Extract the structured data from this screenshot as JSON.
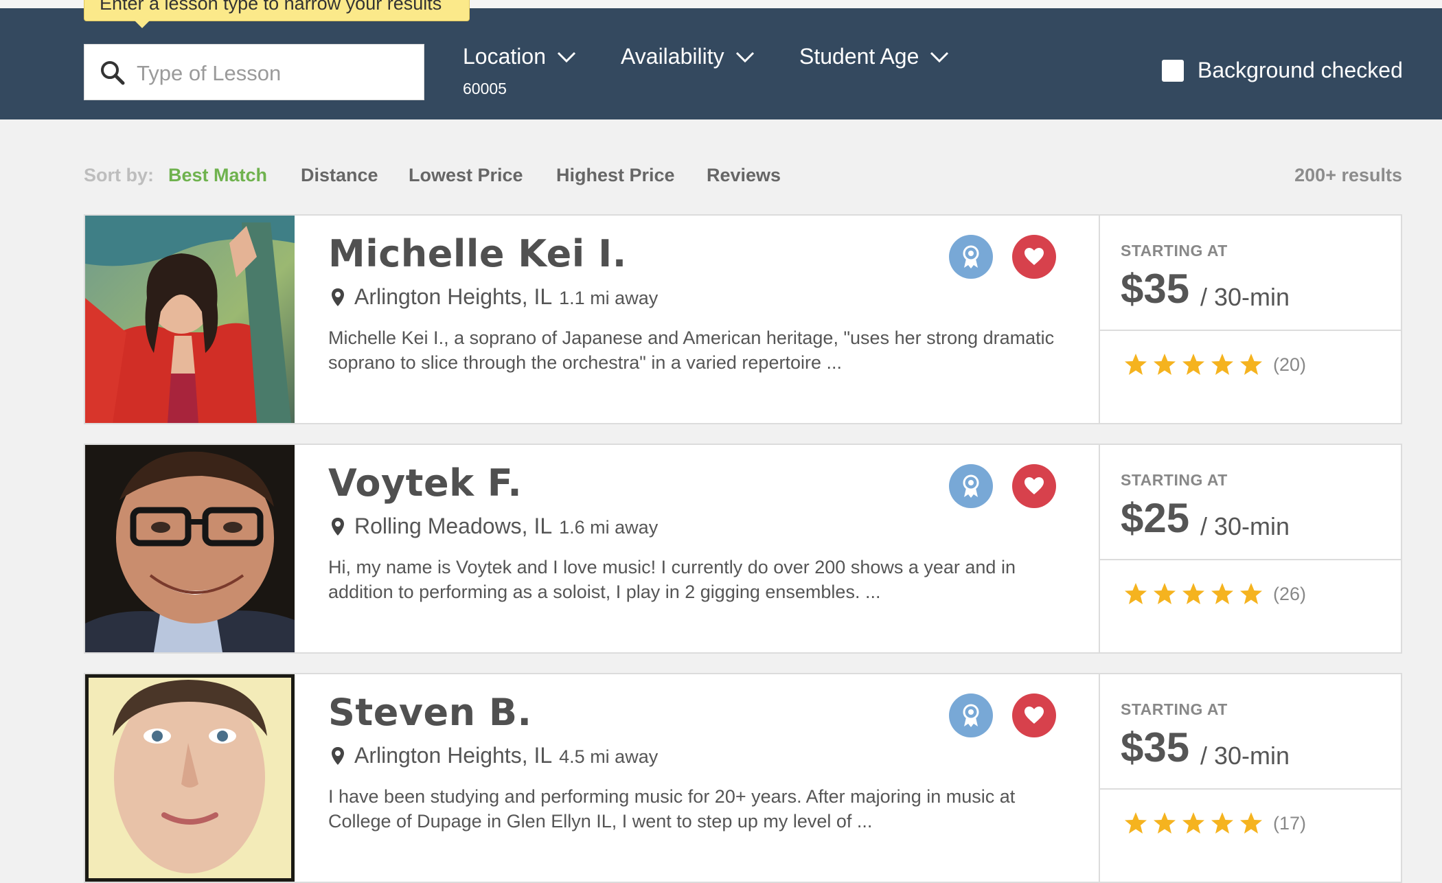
{
  "search": {
    "tooltip": "Enter a lesson type to narrow your results",
    "placeholder": "Type of Lesson"
  },
  "filters": {
    "location": {
      "label": "Location",
      "value": "60005"
    },
    "availability": {
      "label": "Availability"
    },
    "student_age": {
      "label": "Student Age"
    },
    "background_checked": {
      "label": "Background checked",
      "checked": false
    }
  },
  "sort": {
    "label": "Sort by:",
    "options": [
      "Best Match",
      "Distance",
      "Lowest Price",
      "Highest Price",
      "Reviews"
    ],
    "active": "Best Match",
    "results_count": "200+ results"
  },
  "teachers": [
    {
      "name": "Michelle Kei I.",
      "location": "Arlington Heights, IL",
      "distance": "1.1 mi away",
      "description": "Michelle Kei I., a soprano of Japanese and American heritage, \"uses her strong dramatic soprano to slice through the orchestra\" in a varied repertoire ...",
      "starting_label": "STARTING AT",
      "price": "$35",
      "unit": "/ 30-min",
      "rating": 5,
      "reviews": "(20)"
    },
    {
      "name": "Voytek F.",
      "location": "Rolling Meadows, IL",
      "distance": "1.6 mi away",
      "description": "Hi, my name is Voytek and I love music! I currently do over 200 shows a year and in addition to performing as a soloist, I play in 2 gigging ensembles. ...",
      "starting_label": "STARTING AT",
      "price": "$25",
      "unit": "/ 30-min",
      "rating": 5,
      "reviews": "(26)"
    },
    {
      "name": "Steven B.",
      "location": "Arlington Heights, IL",
      "distance": "4.5 mi away",
      "description": "I have been studying and performing music for 20+ years. After majoring in music at College of Dupage in Glen Ellyn IL, I went to step up my level of ...",
      "starting_label": "STARTING AT",
      "price": "$35",
      "unit": "/ 30-min",
      "rating": 5,
      "reviews": "(17)"
    }
  ],
  "icons": {
    "search": "search-icon",
    "chevron": "chevron-down-icon",
    "map_pin": "map-pin-icon",
    "award": "award-ribbon-icon",
    "favorite": "heart-icon",
    "star": "star-icon"
  },
  "colors": {
    "header": "#34495f",
    "active_sort": "#6fb24e",
    "star": "#f5b31f",
    "favorite": "#d7414c",
    "award": "#78a8d6",
    "tooltip": "#fbe98a"
  }
}
